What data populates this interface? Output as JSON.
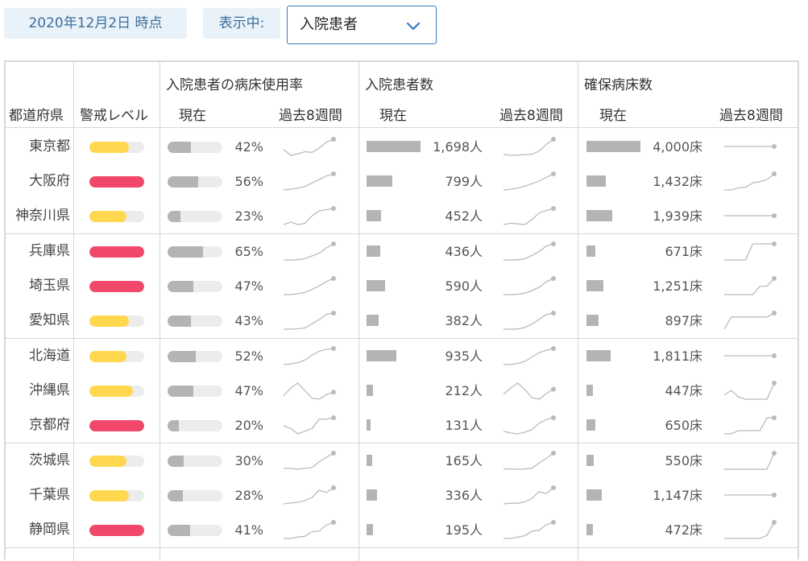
{
  "header": {
    "date": "2020年12月2日 時点",
    "display_label": "表示中:",
    "selected": "入院患者"
  },
  "columns": {
    "prefecture": "都道府県",
    "level": "警戒レベル",
    "usage_group": "入院患者の病床使用率",
    "patients_group": "入院患者数",
    "beds_group": "確保病床数",
    "current": "現在",
    "past8": "過去8週間"
  },
  "colors": {
    "yellow": "#ffd84f",
    "red": "#f0476b",
    "bar": "#b4b4b4",
    "track": "#ececec"
  },
  "rows": [
    {
      "name": "東京都",
      "level_color": "yellow",
      "level_fill": 0.72,
      "usage": "42%",
      "usage_val": 0.42,
      "patients": "1,698人",
      "patients_val": 1698,
      "beds": "4,000床",
      "beds_val": 4000,
      "usage_trend": [
        0.28,
        0.2,
        0.22,
        0.25,
        0.24,
        0.3,
        0.38,
        0.42
      ],
      "patient_trend": [
        560,
        480,
        500,
        540,
        560,
        800,
        1300,
        1698
      ],
      "bed_trend": [
        4000,
        4000,
        4000,
        4000,
        4000,
        4000,
        4000,
        4000
      ]
    },
    {
      "name": "大阪府",
      "level_color": "red",
      "level_fill": 1.0,
      "usage": "56%",
      "usage_val": 0.56,
      "patients": "799人",
      "patients_val": 799,
      "beds": "1,432床",
      "beds_val": 1432,
      "usage_trend": [
        0.1,
        0.12,
        0.15,
        0.2,
        0.3,
        0.4,
        0.5,
        0.56
      ],
      "patient_trend": [
        120,
        150,
        200,
        280,
        380,
        500,
        650,
        799
      ],
      "bed_trend": [
        1200,
        1200,
        1230,
        1240,
        1300,
        1320,
        1350,
        1432
      ]
    },
    {
      "name": "神奈川県",
      "level_color": "yellow",
      "level_fill": 0.68,
      "usage": "23%",
      "usage_val": 0.23,
      "patients": "452人",
      "patients_val": 452,
      "beds": "1,939床",
      "beds_val": 1939,
      "usage_trend": [
        0.1,
        0.12,
        0.1,
        0.11,
        0.17,
        0.21,
        0.22,
        0.23
      ],
      "patient_trend": [
        200,
        220,
        210,
        200,
        280,
        380,
        420,
        452
      ],
      "bed_trend": [
        1939,
        1939,
        1939,
        1939,
        1939,
        1939,
        1939,
        1939
      ]
    },
    {
      "name": "兵庫県",
      "level_color": "red",
      "level_fill": 1.0,
      "usage": "65%",
      "usage_val": 0.65,
      "patients": "436人",
      "patients_val": 436,
      "beds": "671床",
      "beds_val": 671,
      "usage_trend": [
        0.05,
        0.05,
        0.06,
        0.1,
        0.2,
        0.3,
        0.5,
        0.65
      ],
      "patient_trend": [
        40,
        40,
        45,
        70,
        150,
        250,
        380,
        436
      ],
      "bed_trend": [
        400,
        400,
        400,
        400,
        671,
        671,
        671,
        671
      ]
    },
    {
      "name": "埼玉県",
      "level_color": "red",
      "level_fill": 1.0,
      "usage": "47%",
      "usage_val": 0.47,
      "patients": "590人",
      "patients_val": 590,
      "beds": "1,251床",
      "beds_val": 1251,
      "usage_trend": [
        0.1,
        0.1,
        0.12,
        0.15,
        0.22,
        0.3,
        0.4,
        0.47
      ],
      "patient_trend": [
        150,
        150,
        160,
        190,
        260,
        350,
        500,
        590
      ],
      "bed_trend": [
        1000,
        1000,
        1000,
        1000,
        1000,
        1130,
        1130,
        1251
      ]
    },
    {
      "name": "愛知県",
      "level_color": "yellow",
      "level_fill": 0.72,
      "usage": "43%",
      "usage_val": 0.43,
      "patients": "382人",
      "patients_val": 382,
      "beds": "897床",
      "beds_val": 897,
      "usage_trend": [
        0.05,
        0.05,
        0.06,
        0.08,
        0.18,
        0.28,
        0.4,
        0.43
      ],
      "patient_trend": [
        40,
        40,
        45,
        80,
        150,
        250,
        350,
        382
      ],
      "bed_trend": [
        700,
        850,
        850,
        850,
        850,
        850,
        850,
        897
      ]
    },
    {
      "name": "北海道",
      "level_color": "yellow",
      "level_fill": 0.68,
      "usage": "52%",
      "usage_val": 0.52,
      "patients": "935人",
      "patients_val": 935,
      "beds": "1,811床",
      "beds_val": 1811,
      "usage_trend": [
        0.1,
        0.12,
        0.15,
        0.22,
        0.35,
        0.45,
        0.5,
        0.52
      ],
      "patient_trend": [
        200,
        210,
        250,
        350,
        550,
        750,
        850,
        935
      ],
      "bed_trend": [
        1811,
        1811,
        1811,
        1811,
        1811,
        1811,
        1811,
        1811
      ]
    },
    {
      "name": "沖縄県",
      "level_color": "yellow",
      "level_fill": 0.8,
      "usage": "47%",
      "usage_val": 0.47,
      "patients": "212人",
      "patients_val": 212,
      "beds": "447床",
      "beds_val": 447,
      "usage_trend": [
        0.4,
        0.55,
        0.65,
        0.5,
        0.35,
        0.33,
        0.42,
        0.47
      ],
      "patient_trend": [
        180,
        220,
        250,
        210,
        160,
        150,
        185,
        212
      ],
      "bed_trend": [
        420,
        430,
        415,
        410,
        410,
        410,
        410,
        447
      ]
    },
    {
      "name": "京都府",
      "level_color": "red",
      "level_fill": 1.0,
      "usage": "20%",
      "usage_val": 0.2,
      "patients": "131人",
      "patients_val": 131,
      "beds": "650床",
      "beds_val": 650,
      "usage_trend": [
        0.14,
        0.12,
        0.08,
        0.1,
        0.12,
        0.19,
        0.19,
        0.2
      ],
      "patient_trend": [
        50,
        40,
        35,
        45,
        60,
        100,
        120,
        131
      ],
      "bed_trend": [
        600,
        600,
        610,
        610,
        610,
        610,
        650,
        650
      ]
    },
    {
      "name": "茨城県",
      "level_color": "yellow",
      "level_fill": 0.68,
      "usage": "30%",
      "usage_val": 0.3,
      "patients": "165人",
      "patients_val": 165,
      "beds": "550床",
      "beds_val": 550,
      "usage_trend": [
        0.12,
        0.12,
        0.11,
        0.12,
        0.13,
        0.2,
        0.25,
        0.3
      ],
      "patient_trend": [
        60,
        60,
        58,
        60,
        65,
        100,
        130,
        165
      ],
      "bed_trend": [
        450,
        450,
        450,
        450,
        450,
        450,
        450,
        550
      ]
    },
    {
      "name": "千葉県",
      "level_color": "yellow",
      "level_fill": 0.72,
      "usage": "28%",
      "usage_val": 0.28,
      "patients": "336人",
      "patients_val": 336,
      "beds": "1,147床",
      "beds_val": 1147,
      "usage_trend": [
        0.08,
        0.09,
        0.1,
        0.12,
        0.16,
        0.25,
        0.22,
        0.28
      ],
      "patient_trend": [
        100,
        110,
        110,
        130,
        180,
        280,
        250,
        336
      ],
      "bed_trend": [
        1147,
        1147,
        1147,
        1147,
        1147,
        1147,
        1147,
        1147
      ]
    },
    {
      "name": "静岡県",
      "level_color": "red",
      "level_fill": 1.0,
      "usage": "41%",
      "usage_val": 0.41,
      "patients": "195人",
      "patients_val": 195,
      "beds": "472床",
      "beds_val": 472,
      "usage_trend": [
        0.05,
        0.05,
        0.08,
        0.1,
        0.2,
        0.22,
        0.35,
        0.41
      ],
      "patient_trend": [
        20,
        20,
        35,
        50,
        100,
        110,
        170,
        195
      ],
      "bed_trend": [
        420,
        420,
        420,
        420,
        420,
        420,
        430,
        472
      ]
    }
  ]
}
